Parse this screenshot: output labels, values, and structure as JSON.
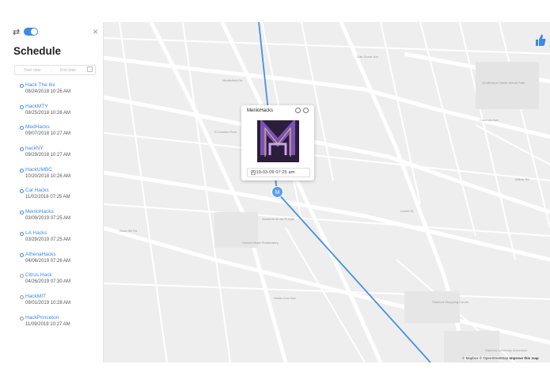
{
  "sidebar": {
    "title": "Schedule",
    "date_range": {
      "start_placeholder": "Start date",
      "separator": "→",
      "end_placeholder": "End date"
    },
    "events": [
      {
        "name": "Hack The 6ix",
        "date": "08/24/2018 10:26 AM"
      },
      {
        "name": "HackMTY",
        "date": "08/25/2018 10:26 AM"
      },
      {
        "name": "MedHacks",
        "date": "09/07/2018 10:27 AM"
      },
      {
        "name": "hackNY",
        "date": "09/29/2018 10:27 AM"
      },
      {
        "name": "HackUMBC",
        "date": "10/20/2018 10:26 AM"
      },
      {
        "name": "Cal Hacks",
        "date": "11/02/2018 07:25 AM"
      },
      {
        "name": "MenloHacks",
        "date": "03/09/2019 07:25 AM"
      },
      {
        "name": "LA Hacks",
        "date": "03/29/2019 07:25 AM"
      },
      {
        "name": "AthenaHacks",
        "date": "04/06/2019 07:26 AM"
      },
      {
        "name": "Citrus Hack",
        "date": "04/26/2019 07:30 AM"
      },
      {
        "name": "HackMIT",
        "date": "09/01/2019 10:28 AM"
      },
      {
        "name": "HackPrinceton",
        "date": "11/09/2019 10:27 AM"
      }
    ]
  },
  "popup": {
    "title": "MenloHacks",
    "logo_letter": "M",
    "datetime": "2019-03-09 07:25 am"
  },
  "marker": {
    "label": "M"
  },
  "map": {
    "attribution": "© Mapbox © OpenStreetMap",
    "improve_link": "Improve this map",
    "street_labels": [
      "Middlefield Rd",
      "El Camino Real",
      "Laurel St",
      "Santa Cruz Ave",
      "Alameda de las Pulgas",
      "Sacred Heart Preparatory",
      "VA Medical Center Menlo Park",
      "Stanford Shopping Center",
      "Oak Grove Ave",
      "Coleman Ave",
      "Willow Rd",
      "Sand Hill Rd",
      "Stanford University Arboretum"
    ]
  },
  "colors": {
    "accent": "#3b8ae6",
    "route": "#4a90e2",
    "map_bg": "#eeeeee"
  },
  "icons": {
    "swap": "swap-icon",
    "close": "close-icon",
    "thumb": "thumbs-up-icon",
    "calendar": "calendar-icon"
  }
}
